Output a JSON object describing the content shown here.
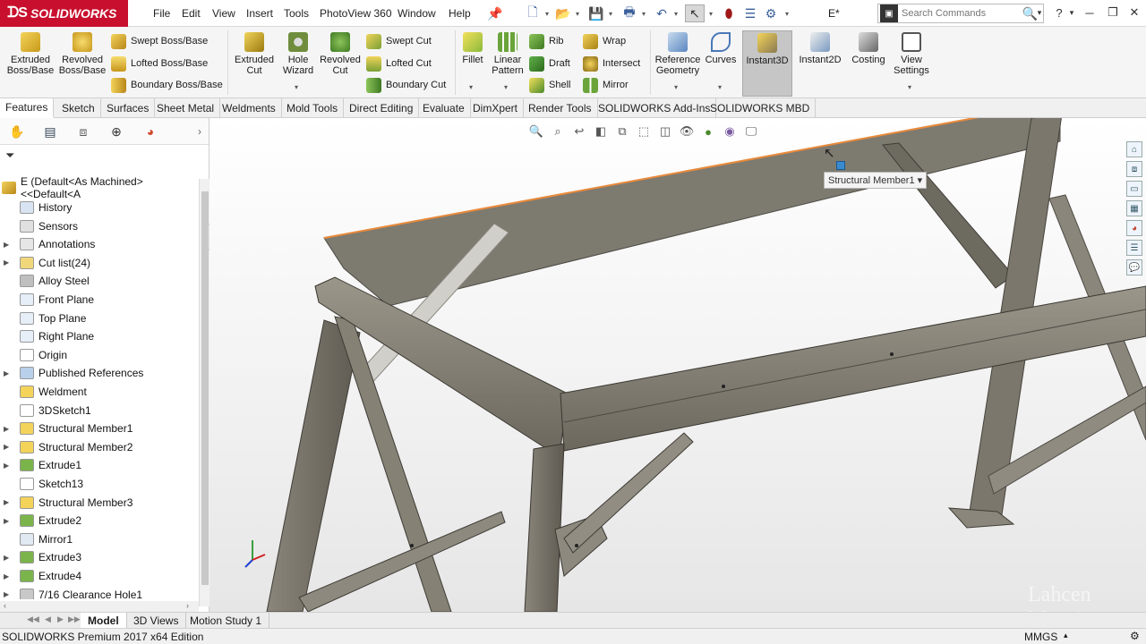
{
  "app": {
    "brand": "SOLIDWORKS",
    "menu": [
      "File",
      "Edit",
      "View",
      "Insert",
      "Tools",
      "PhotoView 360",
      "Window",
      "Help"
    ],
    "doc_title": "E*",
    "search_placeholder": "Search Commands"
  },
  "ribbon": {
    "extruded_boss": "Extruded Boss/Base",
    "revolved_boss": "Revolved Boss/Base",
    "swept_boss": "Swept Boss/Base",
    "lofted_boss": "Lofted Boss/Base",
    "boundary_boss": "Boundary Boss/Base",
    "extruded_cut": "Extruded Cut",
    "hole_wizard": "Hole Wizard",
    "revolved_cut": "Revolved Cut",
    "swept_cut": "Swept Cut",
    "lofted_cut": "Lofted Cut",
    "boundary_cut": "Boundary Cut",
    "fillet": "Fillet",
    "linear_pattern": "Linear Pattern",
    "rib": "Rib",
    "draft": "Draft",
    "shell": "Shell",
    "wrap": "Wrap",
    "intersect": "Intersect",
    "mirror": "Mirror",
    "reference_geometry": "Reference Geometry",
    "curves": "Curves",
    "instant3d": "Instant3D",
    "instant2d": "Instant2D",
    "costing": "Costing",
    "view_settings": "View Settings"
  },
  "cm_tabs": [
    "Features",
    "Sketch",
    "Surfaces",
    "Sheet Metal",
    "Weldments",
    "Mold Tools",
    "Direct Editing",
    "Evaluate",
    "DimXpert",
    "Render Tools",
    "SOLIDWORKS Add-Ins",
    "SOLIDWORKS MBD"
  ],
  "tree": {
    "root": "E  (Default<As Machined><<Default<A",
    "items": [
      {
        "label": "History",
        "icon": "history-icon",
        "expandable": false
      },
      {
        "label": "Sensors",
        "icon": "sensors-icon",
        "expandable": false
      },
      {
        "label": "Annotations",
        "icon": "annotations-icon",
        "expandable": true
      },
      {
        "label": "Cut list(24)",
        "icon": "cut-list-icon",
        "expandable": true
      },
      {
        "label": "Alloy Steel",
        "icon": "material-icon",
        "expandable": false
      },
      {
        "label": "Front Plane",
        "icon": "plane-icon",
        "expandable": false
      },
      {
        "label": "Top Plane",
        "icon": "plane-icon",
        "expandable": false
      },
      {
        "label": "Right Plane",
        "icon": "plane-icon",
        "expandable": false
      },
      {
        "label": "Origin",
        "icon": "origin-icon",
        "expandable": false
      },
      {
        "label": "Published References",
        "icon": "published-references-icon",
        "expandable": true
      },
      {
        "label": "Weldment",
        "icon": "weldment-icon",
        "expandable": false
      },
      {
        "label": "3DSketch1",
        "icon": "3dsketch-icon",
        "expandable": false
      },
      {
        "label": "Structural Member1",
        "icon": "structural-member-icon",
        "expandable": true
      },
      {
        "label": "Structural Member2",
        "icon": "structural-member-icon",
        "expandable": true
      },
      {
        "label": "Extrude1",
        "icon": "extrude-icon",
        "expandable": true
      },
      {
        "label": "Sketch13",
        "icon": "sketch-icon",
        "expandable": false
      },
      {
        "label": "Structural Member3",
        "icon": "structural-member-icon",
        "expandable": true
      },
      {
        "label": "Extrude2",
        "icon": "extrude-icon",
        "expandable": true
      },
      {
        "label": "Mirror1",
        "icon": "mirror-feature-icon",
        "expandable": false
      },
      {
        "label": "Extrude3",
        "icon": "extrude-icon",
        "expandable": true
      },
      {
        "label": "Extrude4",
        "icon": "extrude-icon",
        "expandable": true
      },
      {
        "label": "7/16 Clearance Hole1",
        "icon": "hole-icon",
        "expandable": true
      }
    ]
  },
  "viewport": {
    "tooltip": "Structural Member1",
    "watermark": "Lahcen Musaj"
  },
  "bottom_tabs": [
    "Model",
    "3D Views",
    "Motion Study 1"
  ],
  "status": {
    "edition": "SOLIDWORKS Premium 2017 x64 Edition",
    "units": "MMGS"
  },
  "colors": {
    "brand_red": "#c8102e",
    "feature_yellow": "#e0b928",
    "feature_green": "#6aa43a",
    "steel": "#7d7a70",
    "selection_orange": "#e88a3c"
  }
}
